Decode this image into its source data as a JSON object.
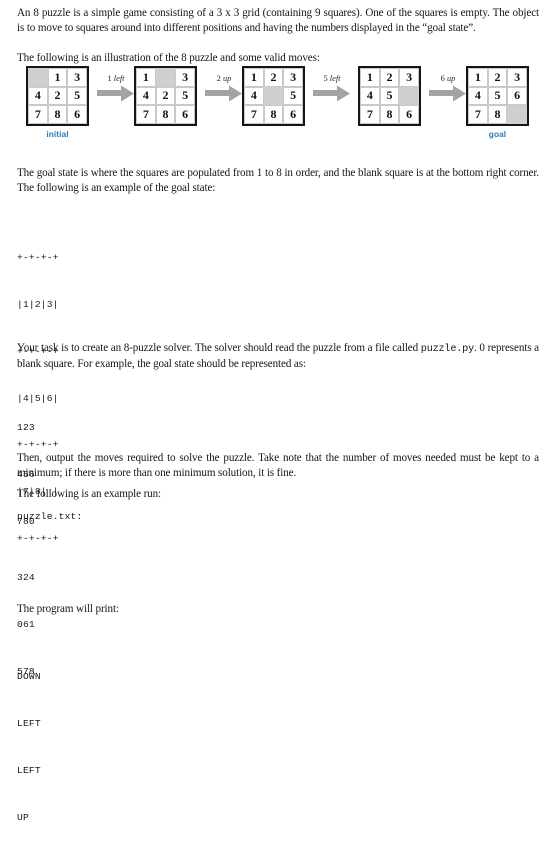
{
  "document": {
    "paragraphs": {
      "intro": "An 8 puzzle is a simple game consisting of a 3 x 3 grid (containing 9 squares). One of the squares is empty. The object is to move to squares around into different positions and having the numbers displayed in the “goal state”.",
      "illustration_lead": "The following is an illustration of the 8 puzzle and some valid moves:",
      "goal_state_desc": "The goal state is where the squares are populated from 1 to 8 in order, and the blank square is at the bottom right corner. The following is an example of the goal state:",
      "task_part1": "Your task is to create an 8-puzzle solver. The solver should read the puzzle from a file called ",
      "task_file": "puzzle.py",
      "task_part2": ". 0 represents a blank square. For example, the goal state should be represented as:",
      "moves_note": "Then, output the moves required to solve the puzzle. Take note that the number of moves needed must be kept to a minimum; if there is more than one minimum solution, it is fine.",
      "example_run_lead": "The following is an example run:",
      "example_file_name": "puzzle.txt:",
      "program_print_lead": "The program will print:"
    },
    "ascii_goal_state": [
      "+-+-+-+",
      "|1|2|3|",
      "+-+-+-+",
      "|4|5|6|",
      "+-+-+-+",
      "|7|8| |",
      "+-+-+-+"
    ],
    "goal_state_numeric": [
      "123",
      "456",
      "780"
    ],
    "example_input_numeric": [
      "324",
      "061",
      "578"
    ],
    "example_output_moves": [
      "DOWN",
      "LEFT",
      "LEFT",
      "UP"
    ],
    "illustration": {
      "caption_initial": "initial",
      "caption_goal": "goal",
      "states": [
        {
          "cells": [
            "",
            "1",
            "3",
            "4",
            "2",
            "5",
            "7",
            "8",
            "6"
          ]
        },
        {
          "cells": [
            "1",
            "",
            "3",
            "4",
            "2",
            "5",
            "7",
            "8",
            "6"
          ]
        },
        {
          "cells": [
            "1",
            "2",
            "3",
            "4",
            "",
            "5",
            "7",
            "8",
            "6"
          ]
        },
        {
          "cells": [
            "1",
            "2",
            "3",
            "4",
            "5",
            "",
            "7",
            "8",
            "6"
          ]
        },
        {
          "cells": [
            "1",
            "2",
            "3",
            "4",
            "5",
            "6",
            "7",
            "8",
            ""
          ]
        }
      ],
      "moves": [
        {
          "number": "1",
          "direction": "left"
        },
        {
          "number": "2",
          "direction": "up"
        },
        {
          "number": "5",
          "direction": "left"
        },
        {
          "number": "6",
          "direction": "up"
        }
      ]
    },
    "colors": {
      "caption_blue": "#2b7bbd",
      "blank_cell": "#cfcfcf",
      "arrow_gray": "#9a9a9a",
      "text": "#15151f"
    }
  }
}
